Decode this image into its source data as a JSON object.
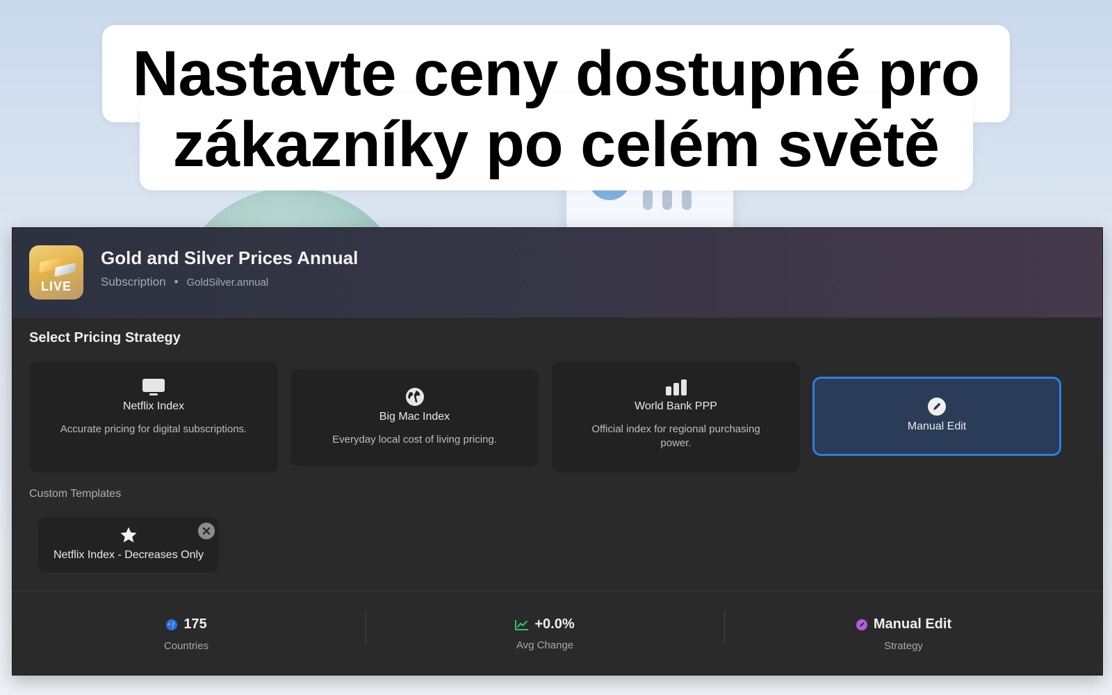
{
  "headline": {
    "line1": "Nastavte ceny dostupné pro",
    "line2": "zákazníky po celém světě"
  },
  "app": {
    "icon_badge": "LIVE",
    "title": "Gold and Silver Prices Annual",
    "type": "Subscription",
    "separator": "•",
    "bundle_id": "GoldSilver.annual"
  },
  "strategy_section": {
    "title": "Select Pricing Strategy",
    "options": [
      {
        "icon": "monitor-icon",
        "name": "Netflix Index",
        "description": "Accurate pricing for digital subscriptions."
      },
      {
        "icon": "globe-icon",
        "name": "Big Mac Index",
        "description": "Everyday local cost of living pricing."
      },
      {
        "icon": "bar-chart-icon",
        "name": "World Bank PPP",
        "description": "Official index for regional purchasing power."
      },
      {
        "icon": "pencil-icon",
        "name": "Manual Edit",
        "description": "",
        "selected": true
      }
    ]
  },
  "custom_templates": {
    "label": "Custom Templates",
    "items": [
      {
        "icon": "star-icon",
        "name": "Netflix Index - Decreases Only"
      }
    ]
  },
  "summary": {
    "countries": {
      "value": "175",
      "label": "Countries",
      "icon": "globe-dot-icon"
    },
    "avg_change": {
      "value": "+0.0%",
      "label": "Avg Change",
      "icon": "trend-icon"
    },
    "strategy": {
      "value": "Manual Edit",
      "label": "Strategy",
      "icon": "pencil-dot-icon"
    }
  },
  "colors": {
    "accent": "#2b7fe6",
    "selected_bg": "#2a3c57",
    "surface": "#2a2a2a",
    "card": "#222222",
    "trend_green": "#36c26a",
    "strategy_purple": "#b35ce0",
    "countries_blue": "#2e6fd6"
  }
}
